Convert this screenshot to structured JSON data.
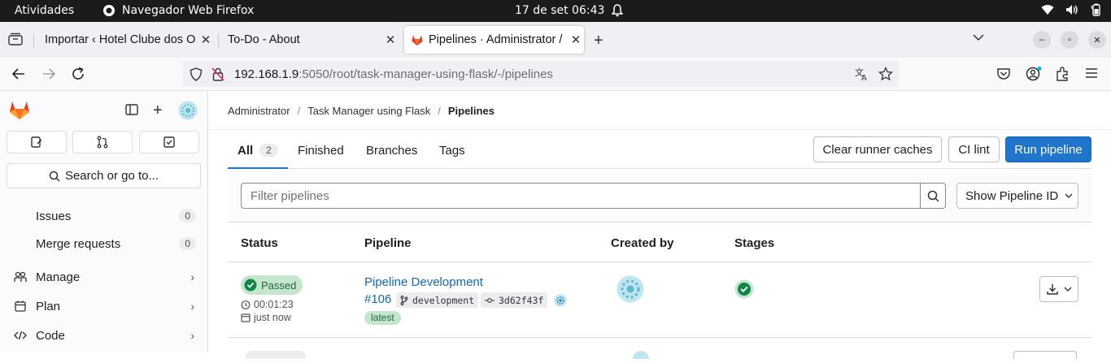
{
  "system_bar": {
    "activities": "Atividades",
    "app_name": "Navegador Web Firefox",
    "clock": "17 de set  06:43"
  },
  "browser": {
    "tabs": [
      {
        "title": "Importar ‹ Hotel Clube dos O",
        "active": false
      },
      {
        "title": "To-Do - About",
        "active": false
      },
      {
        "title": "Pipelines · Administrator /",
        "active": true
      }
    ],
    "url_host": "192.168.1.9",
    "url_rest": ":5050/root/task-manager-using-flask/-/pipelines"
  },
  "sidebar": {
    "search_label": "Search or go to...",
    "items": [
      {
        "label": "Issues",
        "count": "0"
      },
      {
        "label": "Merge requests",
        "count": "0"
      },
      {
        "label": "Manage"
      },
      {
        "label": "Plan"
      },
      {
        "label": "Code"
      }
    ]
  },
  "breadcrumb": [
    "Administrator",
    "Task Manager using Flask",
    "Pipelines"
  ],
  "tabs": {
    "all": "All",
    "all_count": "2",
    "finished": "Finished",
    "branches": "Branches",
    "tags": "Tags"
  },
  "actions": {
    "clear_caches": "Clear runner caches",
    "ci_lint": "CI lint",
    "run_pipeline": "Run pipeline"
  },
  "filter": {
    "placeholder": "Filter pipelines",
    "select_label": "Show Pipeline ID"
  },
  "table": {
    "headers": [
      "Status",
      "Pipeline",
      "Created by",
      "Stages"
    ],
    "rows": [
      {
        "status": "Passed",
        "duration": "00:01:23",
        "time_ago": "just now",
        "name": "Pipeline Development",
        "id": "#106",
        "branch": "development",
        "commit": "3d62f43f",
        "tag": "latest"
      }
    ]
  },
  "colors": {
    "primary": "#1f75cb",
    "success": "#108548",
    "success_bg": "#c3e6cd",
    "gitlab_orange": "#e24329"
  }
}
